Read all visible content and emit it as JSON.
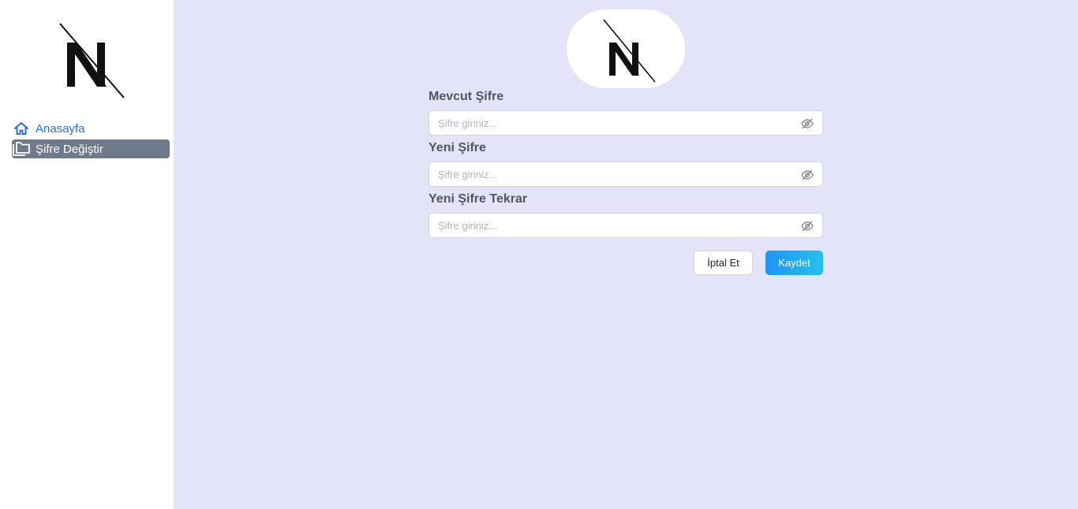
{
  "sidebar": {
    "logo_icon": "n-logo-icon",
    "items": [
      {
        "label": "Anasayfa",
        "icon": "home-icon",
        "active": false
      },
      {
        "label": "Şifre Değiştir",
        "icon": "folders-icon",
        "active": true
      }
    ]
  },
  "main": {
    "logo_icon": "n-logo-icon",
    "fields": [
      {
        "label": "Mevcut Şifre",
        "placeholder": "Şifre giriniz...",
        "value": ""
      },
      {
        "label": "Yeni Şifre",
        "placeholder": "Şifre giriniz...",
        "value": ""
      },
      {
        "label": "Yeni Şifre Tekrar",
        "placeholder": "Şifre giriniz...",
        "value": ""
      }
    ],
    "cancel_label": "İptal Et",
    "save_label": "Kaydet"
  },
  "colors": {
    "background": "#e4e4f8",
    "sidebar_active": "#6e7a8a",
    "link": "#2a6fd6",
    "primary_start": "#1f94f3",
    "primary_end": "#27c0f0"
  }
}
